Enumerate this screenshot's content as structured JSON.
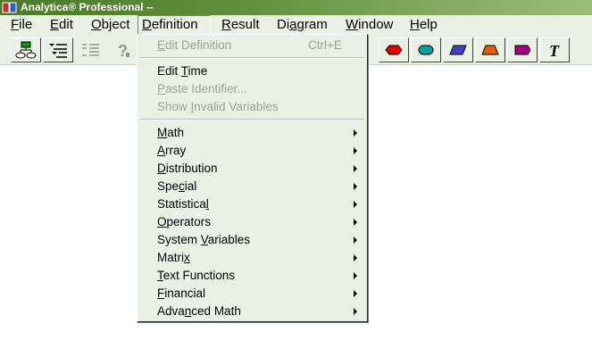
{
  "window": {
    "title": "Analytica® Professional --"
  },
  "menubar": {
    "items": [
      {
        "label_pre": "",
        "accel": "F",
        "label_post": "ile"
      },
      {
        "label_pre": "",
        "accel": "E",
        "label_post": "dit"
      },
      {
        "label_pre": "",
        "accel": "O",
        "label_post": "bject"
      },
      {
        "label_pre": "",
        "accel": "D",
        "label_post": "efinition"
      },
      {
        "label_pre": "",
        "accel": "R",
        "label_post": "esult"
      },
      {
        "label_pre": "Di",
        "accel": "a",
        "label_post": "gram"
      },
      {
        "label_pre": "",
        "accel": "W",
        "label_post": "indow"
      },
      {
        "label_pre": "",
        "accel": "H",
        "label_post": "elp"
      }
    ]
  },
  "toolbar": {
    "tools": [
      {
        "name": "diagram-icon"
      },
      {
        "name": "outline-icon"
      },
      {
        "name": "list-icon"
      },
      {
        "name": "help-icon"
      },
      {
        "name": "chance-node-icon",
        "color": "#e00000"
      },
      {
        "name": "variable-node-icon",
        "color": "#00a0a0"
      },
      {
        "name": "objective-node-icon",
        "color": "#4040c0"
      },
      {
        "name": "constant-node-icon",
        "color": "#e06000"
      },
      {
        "name": "module-node-icon",
        "color": "#a00080"
      },
      {
        "name": "text-tool-icon"
      }
    ]
  },
  "definition_menu": {
    "edit_definition": {
      "label_pre": "",
      "accel": "E",
      "label_post": "dit Definition",
      "shortcut": "Ctrl+E"
    },
    "edit_time": {
      "label_pre": "Edit ",
      "accel": "T",
      "label_post": "ime"
    },
    "paste_identifier": {
      "label_pre": "",
      "accel": "P",
      "label_post": "aste Identifier..."
    },
    "show_invalid": {
      "label_pre": "Show ",
      "accel": "I",
      "label_post": "nvalid Variables"
    },
    "submenus": [
      {
        "label_pre": "",
        "accel": "M",
        "label_post": "ath"
      },
      {
        "label_pre": "",
        "accel": "A",
        "label_post": "rray"
      },
      {
        "label_pre": "",
        "accel": "D",
        "label_post": "istribution"
      },
      {
        "label_pre": "Spe",
        "accel": "c",
        "label_post": "ial"
      },
      {
        "label_pre": "Statistica",
        "accel": "l",
        "label_post": ""
      },
      {
        "label_pre": "",
        "accel": "O",
        "label_post": "perators"
      },
      {
        "label_pre": "System ",
        "accel": "V",
        "label_post": "ariables"
      },
      {
        "label_pre": "Matri",
        "accel": "x",
        "label_post": ""
      },
      {
        "label_pre": "",
        "accel": "T",
        "label_post": "ext Functions"
      },
      {
        "label_pre": "",
        "accel": "F",
        "label_post": "inancial"
      },
      {
        "label_pre": "Adva",
        "accel": "n",
        "label_post": "ced Math"
      }
    ]
  }
}
